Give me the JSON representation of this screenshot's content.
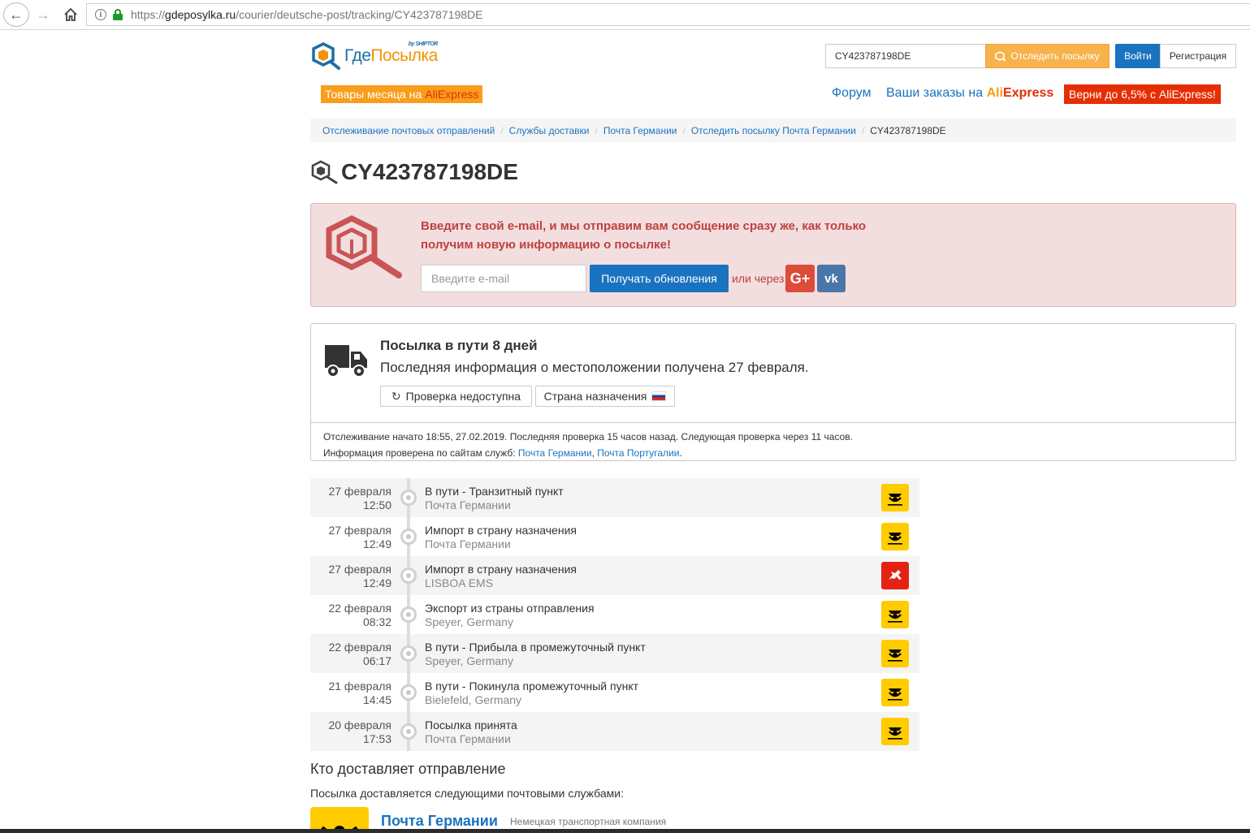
{
  "browser": {
    "url_scheme": "https://",
    "url_host": "gdeposylka.ru",
    "url_path": "/courier/deutsche-post/tracking/CY423787198DE"
  },
  "header": {
    "logo_part1": "Где",
    "logo_part2": "Посылка",
    "logo_sub": "by SHIPTOR",
    "search_value": "CY423787198DE",
    "track_button": "Отследить посылку",
    "login_button": "Войти",
    "register_button": "Регистрация",
    "promo_text": "Товары месяца на",
    "promo_ali": "AliExpress",
    "forum_link": "Форум",
    "orders_text": "Ваши заказы на",
    "orders_ali1": "Ali",
    "orders_ali2": "Express",
    "cashback": "Верни до 6,5% с AliExpress!"
  },
  "breadcrumb": [
    "Отслеживание почтовых отправлений",
    "Службы доставки",
    "Почта Германии",
    "Отследить посылку Почта Германии",
    "CY423787198DE"
  ],
  "title": "CY423787198DE",
  "alert": {
    "text": "Введите свой e-mail, и мы отправим вам сообщение сразу же, как только получим новую информацию о посылке!",
    "email_placeholder": "Введите e-mail",
    "subscribe_button": "Получать обновления",
    "or_via": "или через",
    "gplus": "G+",
    "vk": "vk"
  },
  "status": {
    "title": "Посылка в пути 8 дней",
    "subtitle": "Последняя информация о местоположении получена 27 февраля.",
    "check_button": "Проверка недоступна",
    "dest_button": "Страна назначения",
    "info_line1": "Отслеживание начато 18:55, 27.02.2019. Последняя проверка 15 часов назад. Следующая проверка через 11 часов.",
    "info_line2_prefix": "Информация проверена по сайтам служб:",
    "info_link1": "Почта Германии",
    "info_sep": ",",
    "info_link2": "Почта Португалии",
    "info_end": "."
  },
  "events": [
    {
      "date": "27 февраля",
      "time": "12:50",
      "event": "В пути - Транзитный пункт",
      "place": "Почта Германии",
      "carrier": "deutsche-post"
    },
    {
      "date": "27 февраля",
      "time": "12:49",
      "event": "Импорт в страну назначения",
      "place": "Почта Германии",
      "carrier": "deutsche-post"
    },
    {
      "date": "27 февраля",
      "time": "12:49",
      "event": "Импорт в страну назначения",
      "place": "LISBOA EMS",
      "carrier": "ctt"
    },
    {
      "date": "22 февраля",
      "time": "08:32",
      "event": "Экспорт из страны отправления",
      "place": "Speyer, Germany",
      "carrier": "deutsche-post"
    },
    {
      "date": "22 февраля",
      "time": "06:17",
      "event": "В пути - Прибыла в промежуточный пункт",
      "place": "Speyer, Germany",
      "carrier": "deutsche-post"
    },
    {
      "date": "21 февраля",
      "time": "14:45",
      "event": "В пути - Покинула промежуточный пункт",
      "place": "Bielefeld, Germany",
      "carrier": "deutsche-post"
    },
    {
      "date": "20 февраля",
      "time": "17:53",
      "event": "Посылка принята",
      "place": "Почта Германии",
      "carrier": "deutsche-post"
    }
  ],
  "carriers_section": {
    "title": "Кто доставляет отправление",
    "subtitle": "Посылка доставляется следующими почтовыми службами:",
    "carrier_name": "Почта Германии",
    "carrier_desc": "Немецкая транспортная компания"
  },
  "colors": {
    "link": "#1a73c0",
    "accent_orange": "#f7b24c",
    "alert_bg": "#f2dede",
    "alert_text": "#c04040",
    "dp_yellow": "#ffcc00",
    "ctt_red": "#e32213"
  }
}
